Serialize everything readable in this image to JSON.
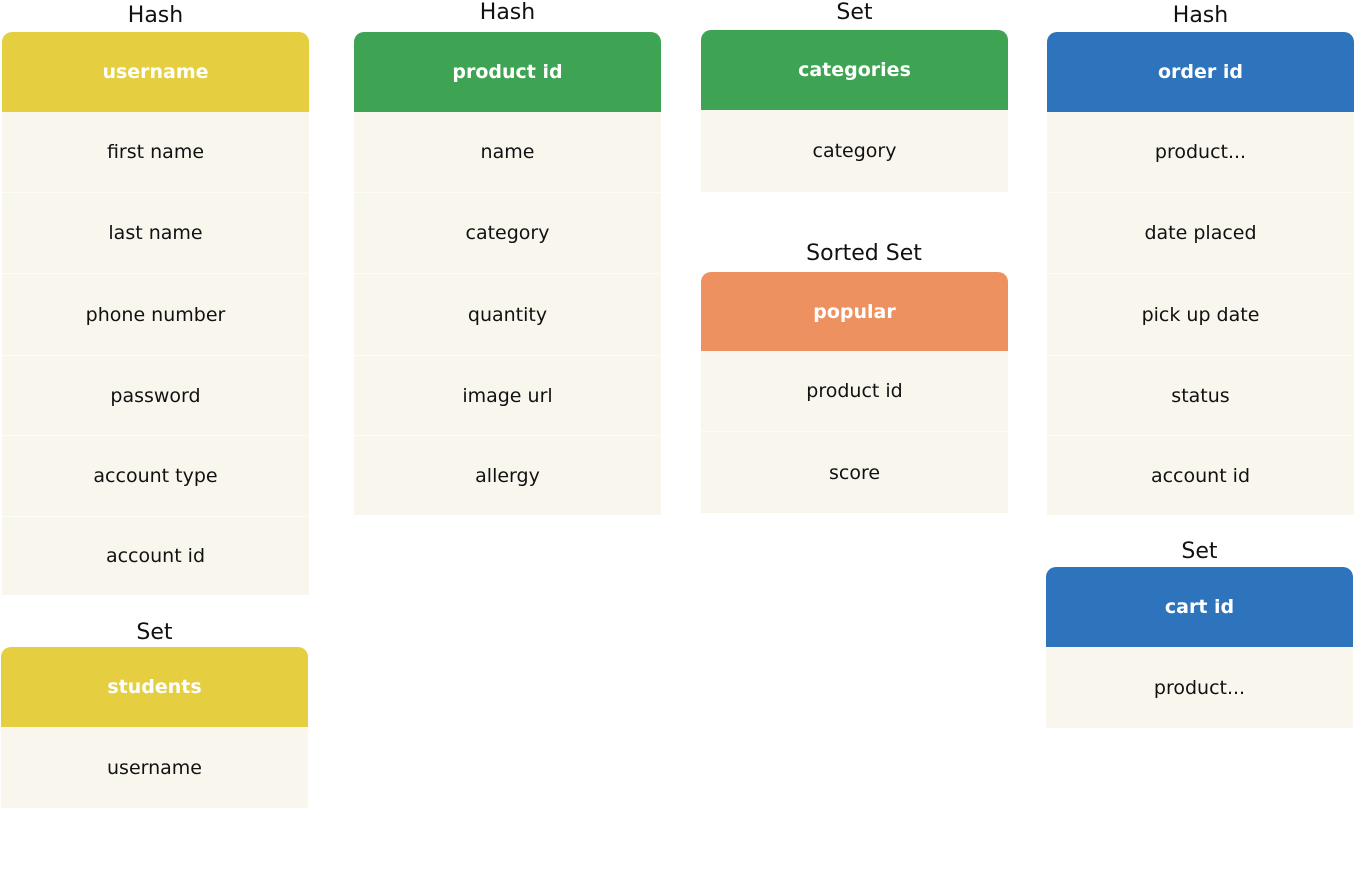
{
  "colors": {
    "yellow": "#e5cf40",
    "green": "#3ea352",
    "orange": "#ee9160",
    "blue": "#2e74bc",
    "row_bg": "#f9f6ee"
  },
  "tables": {
    "users": {
      "type": "Hash",
      "header": "username",
      "fields": [
        "first name",
        "last name",
        "phone number",
        "password",
        "account type",
        "account id"
      ]
    },
    "students": {
      "type": "Set",
      "header": "students",
      "fields": [
        "username"
      ]
    },
    "products": {
      "type": "Hash",
      "header": "product id",
      "fields": [
        "name",
        "category",
        "quantity",
        "image url",
        "allergy"
      ]
    },
    "categories": {
      "type": "Set",
      "header": "categories",
      "fields": [
        "category"
      ]
    },
    "popular": {
      "type": "Sorted Set",
      "header": "popular",
      "fields": [
        "product id",
        "score"
      ]
    },
    "orders": {
      "type": "Hash",
      "header": "order id",
      "fields": [
        "product...",
        "date placed",
        "pick up date",
        "status",
        "account id"
      ]
    },
    "carts": {
      "type": "Set",
      "header": "cart id",
      "fields": [
        "product..."
      ]
    }
  }
}
